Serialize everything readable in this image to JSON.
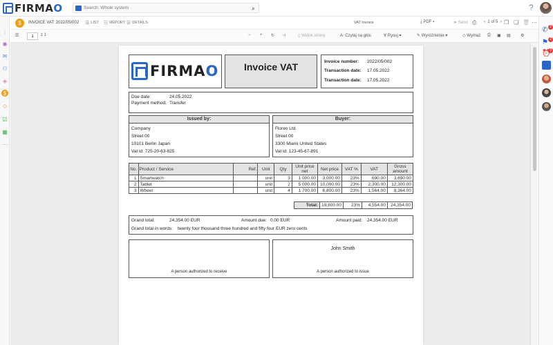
{
  "app": {
    "logo": "FIRMAO",
    "logo_main": "FIRMA",
    "logo_o": "O",
    "help": "?"
  },
  "search": {
    "placeholder": "Search: Whole system"
  },
  "toolbar": {
    "doc_title": "INVOICE VAT: 2022/05/002",
    "list": "LIST",
    "report": "REPORT",
    "details": "DETAILS",
    "vat_select": "VAT Invoice",
    "pdf": "PDF",
    "send": "Send",
    "pager": "1 of 5"
  },
  "viewer": {
    "page": "1",
    "page_of": "z 1",
    "whole_page": "Widok strony",
    "read_aloud": "Czytaj na głos",
    "draw": "Rysuj",
    "highlight": "Wyróżnienie",
    "erase": "Wymaż"
  },
  "invoice": {
    "logo_main": "FIRMA",
    "logo_o": "O",
    "title": "Invoice VAT",
    "number_label": "Invoice number:",
    "number": "2022/05/002",
    "tdate_label": "Transaction date:",
    "tdate": "17.05.2022",
    "tdate2_label": "Transaction date:",
    "tdate2": "17.05.2022",
    "due_label": "Due date:",
    "due": "24.05.2022",
    "payment_label": "Payment method:",
    "payment": "Transfer",
    "issued": {
      "header": "Issued by:",
      "name": "Company",
      "street": "Street 00",
      "city": "10101 Berlin Japan",
      "vat": "Vat id:  725-20-63-825"
    },
    "buyer": {
      "header": "Buyer:",
      "name": "Floreo Ltd.",
      "street": "Street 00",
      "city": "3300 Miami United States",
      "vat": "Vat id:  123-45-67-891"
    },
    "columns": [
      "No.",
      "Product / Service",
      "Ref.",
      "Unit",
      "Qty",
      "Unit price net",
      "Net price",
      "VAT %",
      "VAT",
      "Gross amount"
    ],
    "rows": [
      [
        "1",
        "Smartwatch",
        "",
        "unit",
        "3",
        "1 000.00",
        "3,000.00",
        "23%",
        "690.00",
        "3,690.00"
      ],
      [
        "2",
        "Tablet",
        "",
        "unit",
        "2",
        "5 000.00",
        "10,000.00",
        "23%",
        "2,300.00",
        "12,300.00"
      ],
      [
        "3",
        "Wheel",
        "",
        "unit",
        "4",
        "1 700.00",
        "6,800.00",
        "23%",
        "1,564.00",
        "8,364.00"
      ]
    ],
    "total": {
      "label": "Total:",
      "net": "19,800.00",
      "vat_pct": "23%",
      "vat": "4,554.00",
      "gross": "24,354.00"
    },
    "grand_label": "Grand total:",
    "grand": "24,354.00 EUR",
    "due_amount_label": "Amount due:",
    "due_amount": "0.00 EUR",
    "paid_label": "Amount paid:",
    "paid": "24,354.00 EUR",
    "words_label": "Grand total in words:",
    "words": "twenty four thousand three hundred and fifty four EUR zero cents",
    "receiver_caption": "A person authorized  to receive",
    "issuer_name": "John Smith",
    "issuer_caption": "A person authorized  to issue"
  },
  "rail": {
    "badge1": "2",
    "badge2": "2",
    "badge3": "3"
  },
  "colors": {
    "accent": "#f39c12",
    "brand": "#2a66c8"
  }
}
